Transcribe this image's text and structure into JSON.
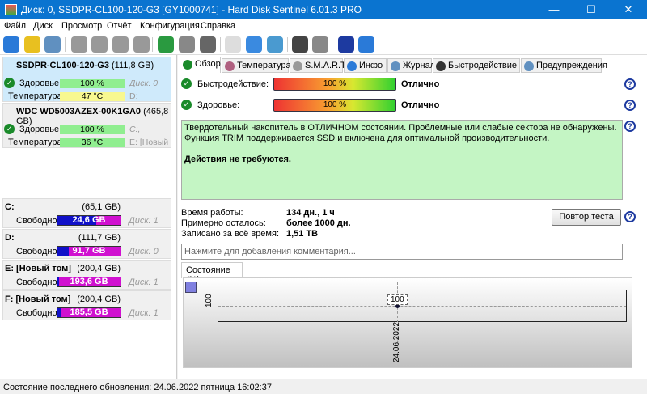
{
  "window": {
    "title": "Диск: 0, SSDPR-CL100-120-G3 [GY1000741]  -  Hard Disk Sentinel 6.01.3 PRO",
    "minimize": "—",
    "maximize": "☐",
    "close": "✕"
  },
  "menu": [
    "Файл",
    "Диск",
    "Просмотр",
    "Отчёт",
    "Конфигурация",
    "Справка"
  ],
  "toolbar": [
    "refresh-icon",
    "alert-icon",
    "disk-info-icon",
    "disk-test-icon",
    "disk-timer-icon",
    "disk-ok-icon",
    "disk-search-icon",
    "network-icon",
    "server-icon",
    "computer-icon",
    "report-icon",
    "sync-icon",
    "remote-icon",
    "monitor-icon",
    "sound-icon",
    "help-icon",
    "info-icon"
  ],
  "disks": [
    {
      "name": "SSDPR-CL100-120-G3",
      "size": "(111,8 GB)",
      "health_label": "Здоровье:",
      "health": "100 %",
      "temp_label": "Температура:",
      "temp": "47 °C",
      "disk": "Диск: 0",
      "part": "D:",
      "temp_color": "#f8f890"
    },
    {
      "name": "WDC WD5003AZEX-00K1GA0",
      "size": "(465,8 GB)",
      "health_label": "Здоровье:",
      "health": "100 %",
      "temp_label": "Температура:",
      "temp": "36 °C",
      "disk": "C:,",
      "part": "E: [Новый т",
      "temp_color": "#90ee90"
    }
  ],
  "volumes": [
    {
      "name": "C:",
      "size": "(65,1 GB)",
      "free_label": "Свободно",
      "free": "24,6 GB",
      "free_pct": 38,
      "disk": "Диск: 1"
    },
    {
      "name": "D:",
      "size": "(111,7 GB)",
      "free_label": "Свободно",
      "free": "91,7 GB",
      "free_pct": 82,
      "disk": "Диск: 0"
    },
    {
      "name": "E: [Новый том]",
      "size": "(200,4 GB)",
      "free_label": "Свободно",
      "free": "193,6 GB",
      "free_pct": 97,
      "disk": "Диск: 1"
    },
    {
      "name": "F: [Новый том]",
      "size": "(200,4 GB)",
      "free_label": "Свободно",
      "free": "185,5 GB",
      "free_pct": 93,
      "disk": "Диск: 1"
    }
  ],
  "tabs": [
    "Обзор",
    "Температура",
    "S.M.A.R.T.",
    "Инфо",
    "Журнал",
    "Быстродействие",
    "Предупреждения"
  ],
  "overview": {
    "perf_label": "Быстродействие:",
    "perf_value": "100 %",
    "perf_pct": 100,
    "perf_status": "Отлично",
    "health_label": "Здоровье:",
    "health_value": "100 %",
    "health_pct": 100,
    "health_status": "Отлично",
    "message": [
      "Твердотельный накопитель в ОТЛИЧНОМ состоянии. Проблемные или слабые сектора не обнаружены.",
      "Функция TRIM поддерживается SSD и включена для оптимальной производительности."
    ],
    "action": "Действия не требуются.",
    "uptime_label": "Время работы:",
    "uptime": "134 дн., 1 ч",
    "remaining_label": "Примерно осталось:",
    "remaining": "более 1000 дн.",
    "written_label": "Записано за всё время:",
    "written": "1,51 TB",
    "retest": "Повтор теста",
    "comment_placeholder": "Нажмите для добавления комментария..."
  },
  "chart_data": {
    "type": "line",
    "tab": "Состояние (%)",
    "x": [
      "24.06.2022"
    ],
    "values": [
      100
    ],
    "y_tick": "100",
    "point_label": "100"
  },
  "status": "Состояние последнего обновления: 24.06.2022 пятница 16:02:37"
}
